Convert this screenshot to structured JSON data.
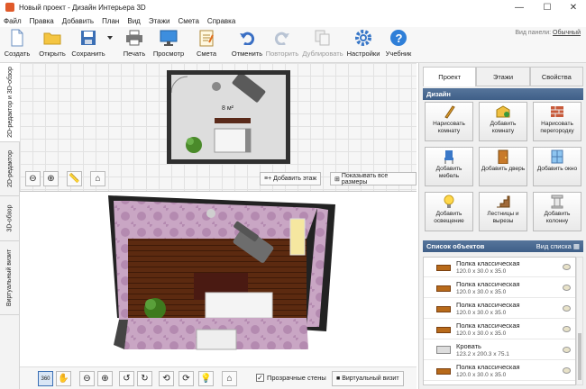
{
  "window": {
    "title": "Новый проект - Дизайн Интерьера 3D",
    "minimize": "—",
    "maximize": "☐",
    "close": "✕"
  },
  "menu": [
    "Файл",
    "Правка",
    "Добавить",
    "План",
    "Вид",
    "Этажи",
    "Смета",
    "Справка"
  ],
  "toolbar": {
    "create": "Создать",
    "open": "Открыть",
    "save": "Сохранить",
    "print": "Печать",
    "preview": "Просмотр",
    "estimate": "Смета",
    "undo": "Отменить",
    "redo": "Повторить",
    "duplicate": "Дублировать",
    "settings": "Настройки",
    "tutorial": "Учебник"
  },
  "panel_view": {
    "label": "Вид панели:",
    "value": "Обычный"
  },
  "side_tabs": [
    "2D-редактор и 3D-обзор",
    "2D-редактор",
    "3D-обзор",
    "Виртуальный визит"
  ],
  "editor2d": {
    "add_floor": "Добавить этаж",
    "show_all_sizes": "Показывать все размеры",
    "area_label": "8 м²"
  },
  "view3d": {
    "transparent_walls": "Прозрачные стены",
    "transparent_walls_checked": true,
    "virtual_visit": "Виртуальный визит"
  },
  "right_tabs": [
    "Проект",
    "Этажи",
    "Свойства"
  ],
  "design": {
    "heading": "Дизайн",
    "buttons": [
      "Нарисовать комнату",
      "Добавить комнату",
      "Нарисовать перегородку",
      "Добавить мебель",
      "Добавить дверь",
      "Добавить окно",
      "Добавить освещение",
      "Лестницы и вырезы",
      "Добавить колонну"
    ]
  },
  "objects": {
    "heading": "Список объектов",
    "view_list": "Вид списка",
    "items": [
      {
        "name": "Полка классическая",
        "size": "120.0 x 30.0 x 35.0"
      },
      {
        "name": "Полка классическая",
        "size": "120.0 x 30.0 x 35.0"
      },
      {
        "name": "Полка классическая",
        "size": "120.0 x 30.0 x 35.0"
      },
      {
        "name": "Полка классическая",
        "size": "120.0 x 30.0 x 35.0"
      },
      {
        "name": "Кровать",
        "size": "123.2 x 200.3 x 75.1"
      },
      {
        "name": "Полка классическая",
        "size": "120.0 x 30.0 x 35.0"
      }
    ]
  }
}
